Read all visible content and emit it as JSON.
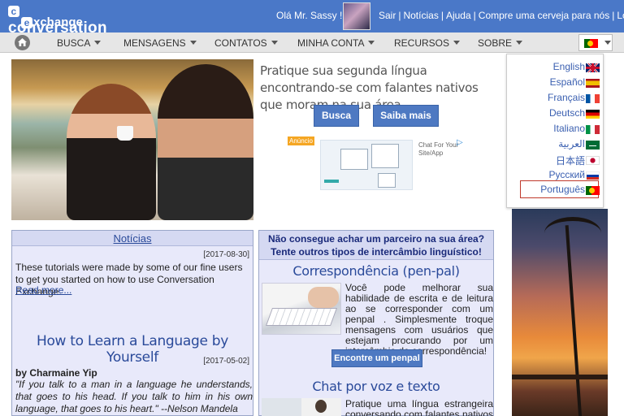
{
  "header": {
    "logo_line1": "conversation",
    "logo_line2": "xchange",
    "logo_badge1": "c",
    "logo_badge2": "e",
    "greeting": "Olá Mr. Sassy !",
    "links": [
      "Sair",
      "Notícias",
      "Ajuda",
      "Compre uma cerveja para nós",
      "Loja"
    ],
    "separator": "|"
  },
  "nav": {
    "items": [
      "BUSCA",
      "MENSAGENS",
      "CONTATOS",
      "MINHA CONTA",
      "RECURSOS",
      "SOBRE"
    ]
  },
  "hero": {
    "tagline": "Pratique sua segunda língua encontrando-se com falantes nativos que moram na sua área",
    "btn_search": "Busca",
    "btn_more": "Saiba mais"
  },
  "ad": {
    "badge": "Anúncio",
    "text": "Chat For Your Site/App",
    "icon": "▷"
  },
  "languages": {
    "items": [
      {
        "label": "English",
        "flag": "uk"
      },
      {
        "label": "Español",
        "flag": "es"
      },
      {
        "label": "Français",
        "flag": "fr"
      },
      {
        "label": "Deutsch",
        "flag": "de"
      },
      {
        "label": "Italiano",
        "flag": "it"
      },
      {
        "label": "العربية",
        "flag": "sa"
      },
      {
        "label": "日本語",
        "flag": "jp"
      },
      {
        "label": "Русский",
        "flag": "ru"
      },
      {
        "label": "Português",
        "flag": "pt"
      }
    ],
    "selected": "Português"
  },
  "news": {
    "heading": "Notícias",
    "date1": "[2017-08-30]",
    "body1": "These tutorials were made by some of our fine users to get you started on how to use Conversation Exchange.",
    "read_more": "Read more...",
    "title2": "How to Learn a Language by Yourself",
    "date2": "[2017-05-02]",
    "byline": "by Charmaine Yip",
    "quote": "\"If you talk to a man in a language he understands, that goes to his head. If you talk to him in his own language, that goes to his heart.\" --Nelson Mandela"
  },
  "exchange": {
    "heading": "Não consegue achar um parceiro na sua área? Tente outros tipos de intercâmbio linguístico!",
    "penpal_title": "Correspondência (pen-pal)",
    "penpal_text": "Você pode melhorar sua habilidade de escrita e de leitura ao se corresponder com um penpal . Simplesmente troque mensagens com usuários que estejam procurando por um intercâmbio de correspondência!",
    "penpal_button": "Encontre um penpal",
    "chat_title": "Chat por voz e texto",
    "chat_text": "Pratique uma língua estrangeira conversando com falantes nativos e"
  }
}
